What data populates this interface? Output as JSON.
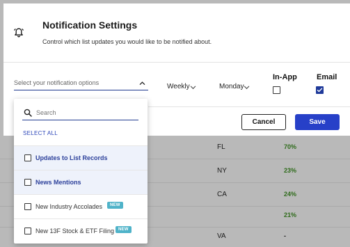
{
  "modal": {
    "title": "Notification Settings",
    "subtitle": "Control which list updates you would like to be notified about.",
    "select_placeholder": "Select your notification options",
    "frequency": "Weekly",
    "day": "Monday",
    "col_inapp": "In-App",
    "col_email": "Email",
    "inapp_checked": false,
    "email_checked": true,
    "cancel_label": "Cancel",
    "save_label": "Save"
  },
  "dropdown": {
    "search_placeholder": "Search",
    "select_all": "SELECT ALL",
    "options": [
      {
        "label": "Updates to List Records",
        "selected": true,
        "badge": ""
      },
      {
        "label": "News Mentions",
        "selected": true,
        "badge": ""
      },
      {
        "label": "New Industry Accolades",
        "selected": false,
        "badge": "NEW"
      },
      {
        "label": "New 13F Stock & ETF Filing",
        "selected": false,
        "badge": "NEW"
      }
    ]
  },
  "background_table": {
    "rows": [
      {
        "state": "FL",
        "pct": "70%"
      },
      {
        "state": "NY",
        "pct": "23%"
      },
      {
        "state": "CA",
        "pct": "24%"
      },
      {
        "state": "",
        "pct": "21%"
      },
      {
        "state": "VA",
        "pct": "-"
      }
    ]
  },
  "colors": {
    "accent": "#2740c8",
    "link": "#2b45b8",
    "badge": "#4fb3c9",
    "positive": "#2e6b1a"
  }
}
